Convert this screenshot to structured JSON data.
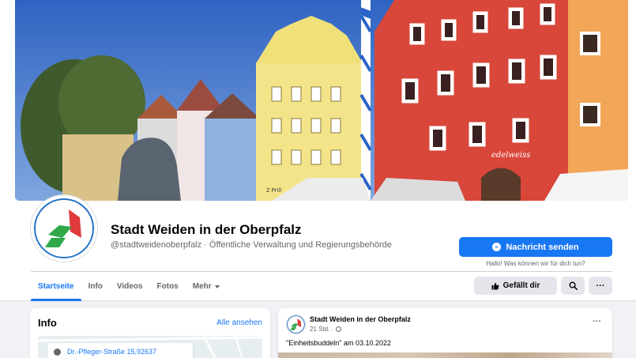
{
  "page": {
    "name": "Stadt Weiden in der Oberpfalz",
    "handle_line": "@stadtweidenoberpfalz · Öffentliche Verwaltung und Regierungsbehörde",
    "brand_color": "#1877f2"
  },
  "cover": {
    "shop_sign": "edelweiss",
    "sign_small": "2 Prill"
  },
  "actions": {
    "message_label": "Nachricht senden",
    "message_hint": "Hallo! Was können wir für dich tun?",
    "like_label": "Gefällt dir",
    "more_label": "···",
    "icons": {
      "message": "messenger-icon",
      "like": "thumbs-up-icon",
      "search": "search-icon",
      "more": "more-dots-icon"
    }
  },
  "tabs": [
    {
      "label": "Startseite",
      "active": true
    },
    {
      "label": "Info",
      "active": false
    },
    {
      "label": "Videos",
      "active": false
    },
    {
      "label": "Fotos",
      "active": false
    },
    {
      "label": "Mehr",
      "active": false
    }
  ],
  "info_card": {
    "title": "Info",
    "see_all": "Alle ansehen",
    "address": "Dr.-Pfleger-Straße 15,92637"
  },
  "post": {
    "author": "Stadt Weiden in der Oberpfalz",
    "time": "21 Std. ·",
    "menu": "···",
    "text": "\"Einheitsbuddeln\" am 03.10.2022"
  }
}
